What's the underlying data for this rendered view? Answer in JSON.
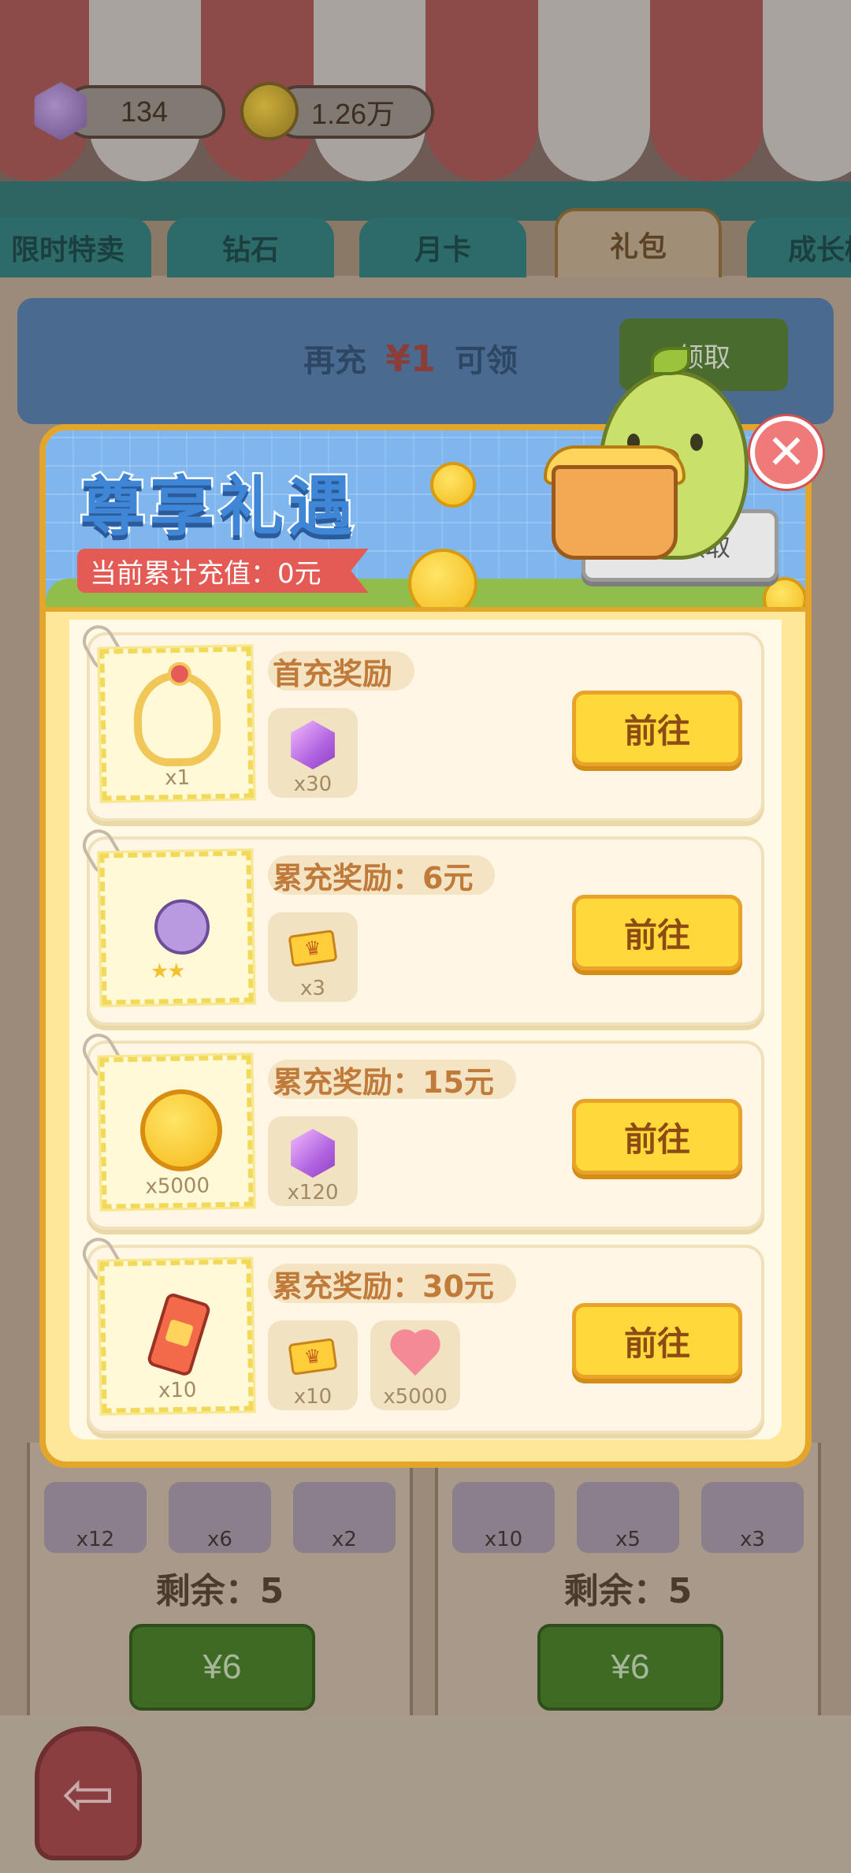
{
  "resources": {
    "gems": "134",
    "coins": "1.26万"
  },
  "tabs": [
    "限时特卖",
    "钻石",
    "月卡",
    "礼包",
    "成长榜"
  ],
  "banner": {
    "prefix": "再充",
    "amount": "¥1",
    "suffix": "可领",
    "button": "领取"
  },
  "modal": {
    "title": "尊享礼遇",
    "total_label": "当前累计充值：0元",
    "claim_all": "一键领取",
    "close": "✕",
    "rows": [
      {
        "title": "首充奖励",
        "main_qty": "x1",
        "rewards": [
          "x30"
        ],
        "button": "前往"
      },
      {
        "title": "累充奖励：6元",
        "main_qty": "",
        "rewards": [
          "x3"
        ],
        "button": "前往"
      },
      {
        "title": "累充奖励：15元",
        "main_qty": "x5000",
        "rewards": [
          "x120"
        ],
        "button": "前往"
      },
      {
        "title": "累充奖励：30元",
        "main_qty": "x10",
        "rewards": [
          "x10",
          "x5000"
        ],
        "button": "前往"
      }
    ]
  },
  "background_cards": {
    "left": {
      "items": [
        "x12",
        "x6",
        "x2"
      ],
      "remain": "剩余：5",
      "price": "¥6"
    },
    "right": {
      "items": [
        "x10",
        "x5",
        "x3"
      ],
      "remain": "剩余：5",
      "price": "¥6"
    }
  },
  "footer": {
    "back_icon": "⇦"
  },
  "colors": {
    "modal_border": "#e3a62a",
    "goto_button": "#ffd83a",
    "title_blue": "#3f87d6",
    "close_red": "#f07a7a"
  }
}
